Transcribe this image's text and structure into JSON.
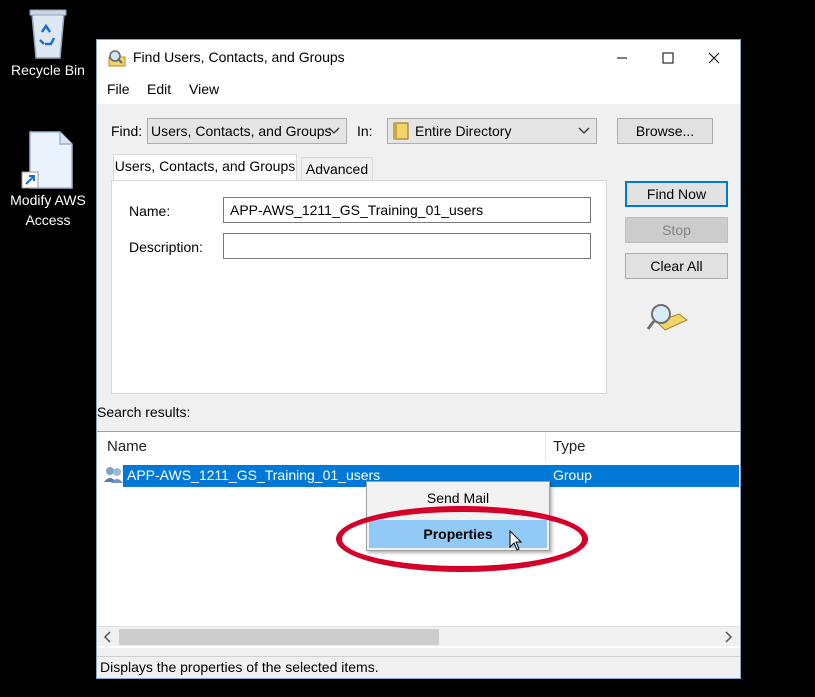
{
  "desktop": {
    "icons": [
      {
        "name": "recycle-bin-icon",
        "label": "Recycle Bin"
      },
      {
        "name": "document-shortcut-icon",
        "label": "Modify AWS Access"
      }
    ]
  },
  "window": {
    "title": "Find Users, Contacts, and Groups",
    "menu": [
      "File",
      "Edit",
      "View"
    ],
    "find_label": "Find:",
    "find_value": "Users, Contacts, and Groups",
    "in_label": "In:",
    "in_value": "Entire Directory",
    "browse_label": "Browse...",
    "tabs": [
      "Users, Contacts, and Groups",
      "Advanced"
    ],
    "name_label": "Name:",
    "name_value": "APP-AWS_1211_GS_Training_01_users",
    "description_label": "Description:",
    "description_value": "",
    "find_now_label": "Find Now",
    "stop_label": "Stop",
    "clear_all_label": "Clear All",
    "search_results_label": "Search results:",
    "columns": [
      "Name",
      "Type"
    ],
    "results": [
      {
        "name": "APP-AWS_1211_GS_Training_01_users",
        "type": "Group"
      }
    ],
    "status_text": "Displays the properties of the selected items."
  },
  "context_menu": {
    "items": [
      "Send Mail",
      "Properties"
    ]
  },
  "colors": {
    "selection": "#0078d7",
    "highlight": "#91c9f7",
    "annotation": "#d4002a"
  }
}
